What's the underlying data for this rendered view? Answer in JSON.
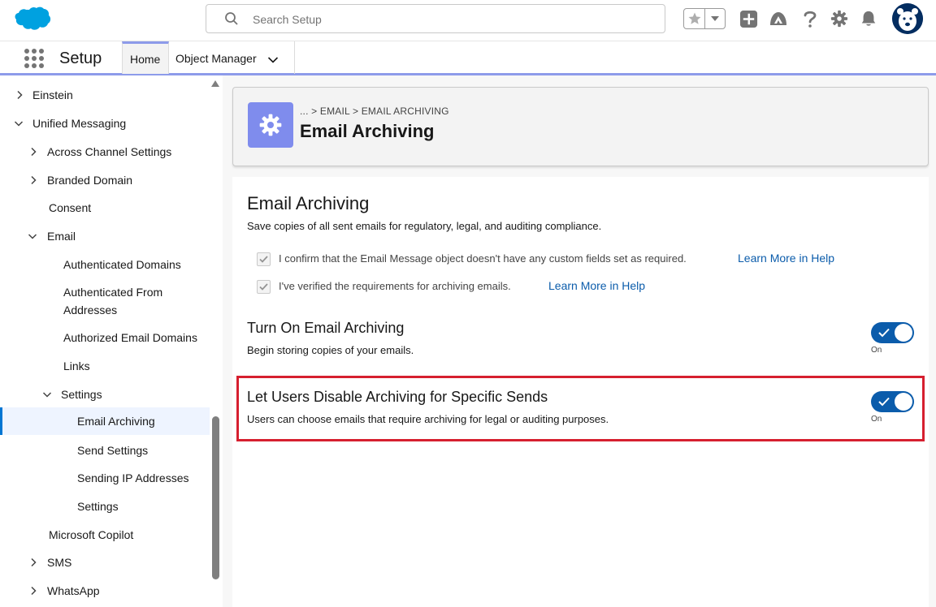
{
  "header": {
    "search_placeholder": "Search Setup",
    "icons": [
      "salesforce-cloud-logo",
      "search-icon",
      "star-icon",
      "dropdown-icon",
      "plus-icon",
      "trailhead-icon",
      "help-icon",
      "gear-icon",
      "bell-icon",
      "avatar"
    ]
  },
  "context": {
    "app_name": "Setup",
    "tabs": [
      {
        "label": "Home",
        "active": true
      },
      {
        "label": "Object Manager"
      }
    ]
  },
  "sidebar": {
    "items": [
      {
        "label": "Einstein",
        "chevron": "right"
      },
      {
        "label": "Unified Messaging",
        "chevron": "down"
      },
      {
        "label": "Across Channel Settings",
        "chevron": "right"
      },
      {
        "label": "Branded Domain",
        "chevron": "right"
      },
      {
        "label": "Consent"
      },
      {
        "label": "Email",
        "chevron": "down"
      },
      {
        "label": "Authenticated Domains"
      },
      {
        "label": "Authenticated From Addresses"
      },
      {
        "label": "Authorized Email Domains"
      },
      {
        "label": "Links"
      },
      {
        "label": "Settings",
        "chevron": "down"
      },
      {
        "label": "Email Archiving",
        "selected": true
      },
      {
        "label": "Send Settings"
      },
      {
        "label": "Sending IP Addresses"
      },
      {
        "label": "Settings"
      },
      {
        "label": "Microsoft Copilot"
      },
      {
        "label": "SMS",
        "chevron": "right"
      },
      {
        "label": "WhatsApp",
        "chevron": "right"
      }
    ]
  },
  "page_header": {
    "breadcrumb": "... > EMAIL > EMAIL ARCHIVING",
    "title": "Email Archiving"
  },
  "card": {
    "title": "Email Archiving",
    "description": "Save copies of all sent emails for regulatory, legal, and auditing compliance.",
    "checkboxes": [
      {
        "label": "I confirm that the Email Message object doesn't have any custom fields set as required.",
        "link": "Learn More in Help",
        "checked": true
      },
      {
        "label": "I've verified the requirements for archiving emails.",
        "link": "Learn More in Help",
        "checked": true
      }
    ],
    "settings": [
      {
        "title": "Turn On Email Archiving",
        "description": "Begin storing copies of your emails.",
        "state": "On"
      },
      {
        "title": "Let Users Disable Archiving for Specific Sends",
        "description": "Users can choose emails that require archiving for legal or auditing purposes.",
        "state": "On"
      }
    ]
  },
  "colors": {
    "brand_blue": "#0b5cab",
    "setup_icon_bg": "#7f8ced",
    "highlight_red": "#d61f2f",
    "cloud_blue": "#00a1e0"
  }
}
